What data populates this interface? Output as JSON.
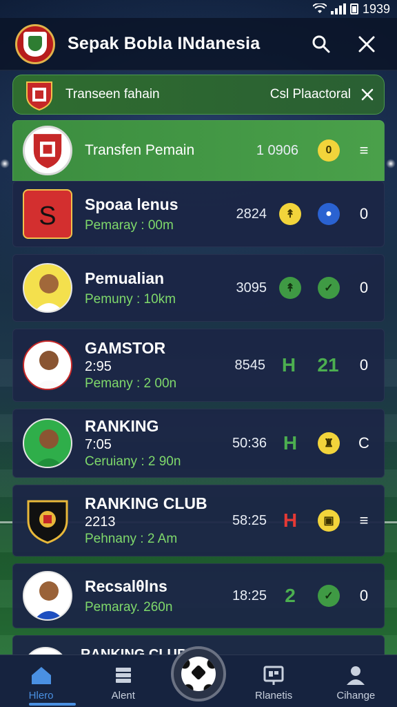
{
  "status": {
    "time": "1939"
  },
  "header": {
    "title": "Sepak Bobla INdanesia"
  },
  "banner": {
    "label": "Transeen fahain",
    "right": "Csl Plaactoral"
  },
  "featured": {
    "label": "Transfen Pemain",
    "value": "1 0906",
    "badge": "0"
  },
  "rows": [
    {
      "name": "Spoaa lenus",
      "sub": "",
      "meta": "Pemaray : 00m",
      "num": "2824",
      "icon1": "yellow",
      "icon2": "blue",
      "trail": "0"
    },
    {
      "name": "Pemualian",
      "sub": "",
      "meta": "Pemuny : 10km",
      "num": "3095",
      "icon1": "green",
      "icon2": "green",
      "trail": "0"
    },
    {
      "name": "GAMSTOR",
      "sub": "2:95",
      "meta": "Pemany : 2 00n",
      "num": "8545",
      "icon1": "H",
      "icon2": "21",
      "trail": "0"
    },
    {
      "name": "RANKING",
      "sub": "7:05",
      "meta": "Ceruiany : 2 90n",
      "num": "50:36",
      "icon1": "H",
      "icon2": "yellow",
      "trail": "C"
    },
    {
      "name": "RANKING CLUB",
      "sub": "2213",
      "meta": "Pehnany : 2 Am",
      "num": "58:25",
      "icon1": "H",
      "icon2": "yellow",
      "trail": "≡"
    },
    {
      "name": "Recsalθlns",
      "sub": "",
      "meta": "Pemaray. 260n",
      "num": "18:25",
      "icon1": "2",
      "icon2": "green",
      "trail": "0"
    },
    {
      "name": "RANKING CLUB",
      "sub": "",
      "meta": "",
      "num": "",
      "icon1": "",
      "icon2": "",
      "trail": ""
    }
  ],
  "nav": [
    {
      "label": "Hlero",
      "icon": "home-icon"
    },
    {
      "label": "Alent",
      "icon": "stack-icon"
    },
    {
      "label": "",
      "icon": "soccer-ball-icon"
    },
    {
      "label": "Rlanetis",
      "icon": "board-icon"
    },
    {
      "label": "Cihange",
      "icon": "profile-icon"
    }
  ],
  "colors": {
    "accent_green": "#4aa04a",
    "meta_green": "#7fd96b",
    "nav_active": "#4a90e2"
  }
}
